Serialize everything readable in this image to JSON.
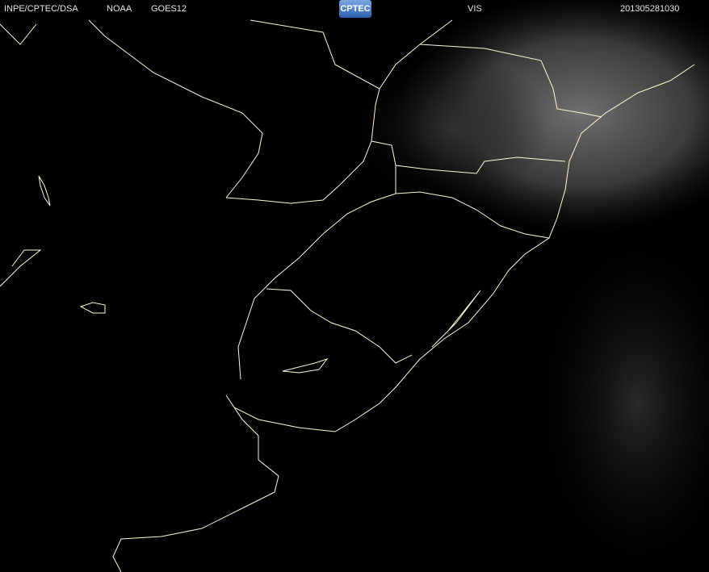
{
  "header": {
    "source": "INPE/CPTEC/DSA",
    "agency": "NOAA",
    "satellite": "GOES12",
    "logo": "CPTEC",
    "channel": "VIS",
    "timestamp": "201305281030"
  },
  "colors": {
    "coastline": "#fffbd0",
    "cloud": "#8a8a8a"
  }
}
